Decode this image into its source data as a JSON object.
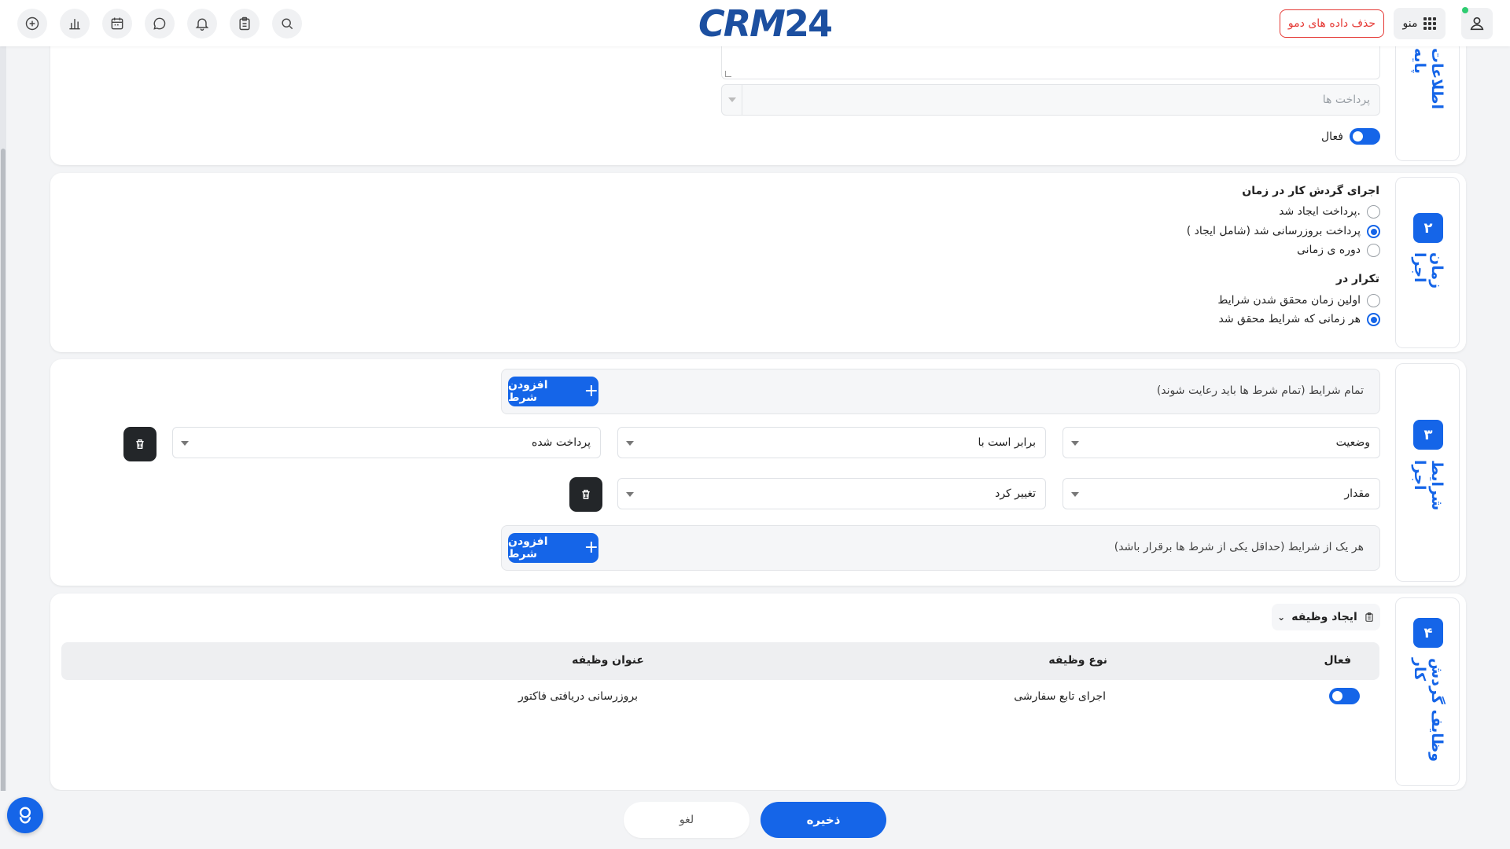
{
  "header": {
    "logo_part1": "CRM",
    "logo_part2": "24",
    "demo_button": "حذف داده های دمو",
    "menu_label": "منو",
    "icons": [
      "add-icon",
      "chart-icon",
      "calendar-icon",
      "chat-icon",
      "bell-icon",
      "clipboard-icon",
      "search-icon"
    ]
  },
  "section1": {
    "tab_label": "اطلاعات پایه",
    "payments_placeholder": "پرداخت ها",
    "active_label": "فعال"
  },
  "section2": {
    "tab_number": "۲",
    "tab_label": "زمان اجرا",
    "run_heading": "اجرای گردش کار در زمان",
    "run_options": [
      "پرداخت ایجاد شد.",
      "پرداخت بروزرسانی شد (شامل ایجاد )",
      "دوره ی زمانی"
    ],
    "run_selected": 1,
    "repeat_heading": "تکرار در",
    "repeat_options": [
      "اولین زمان محقق شدن شرایط",
      "هر زمانی که شرایط محقق شد"
    ],
    "repeat_selected": 1
  },
  "section3": {
    "tab_number": "۳",
    "tab_label": "شرایط اجرا",
    "all_conditions_label": "تمام شرایط (تمام شرط ها باید رعایت شوند)",
    "any_conditions_label": "هر یک از شرایط (حداقل یکی از شرط ها برقرار باشد)",
    "add_condition": "افزودن شرط",
    "row1": {
      "field": "وضعیت",
      "operator": "برابر است با",
      "value": "پرداخت شده"
    },
    "row2": {
      "field": "مقدار",
      "operator": "تغییر کرد"
    }
  },
  "section4": {
    "tab_number": "۴",
    "tab_label": "وظایف گردش کار",
    "create_task": "ایجاد وظیفه",
    "columns": {
      "active": "فعال",
      "type": "نوع وظیفه",
      "title": "عنوان وظیفه"
    },
    "rows": [
      {
        "active": true,
        "type": "اجرای تابع سفارشی",
        "title": "بروزرسانی دریافتی فاکتور"
      }
    ]
  },
  "footer": {
    "cancel": "لغو",
    "save": "ذخیره"
  },
  "colors": {
    "primary": "#1565e8",
    "danger": "#e53935",
    "dark": "#232629"
  }
}
